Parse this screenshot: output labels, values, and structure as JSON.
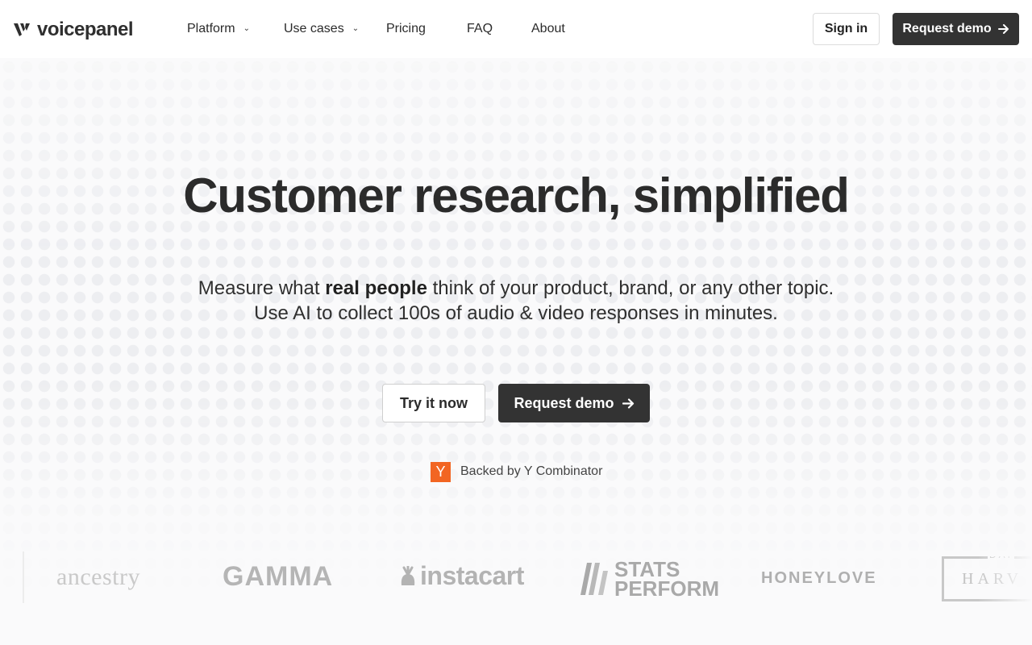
{
  "header": {
    "brand": "voicepanel",
    "nav": [
      {
        "label": "Platform",
        "has_dropdown": true
      },
      {
        "label": "Use cases",
        "has_dropdown": true
      },
      {
        "label": "Pricing",
        "has_dropdown": false
      },
      {
        "label": "FAQ",
        "has_dropdown": false
      },
      {
        "label": "About",
        "has_dropdown": false
      }
    ],
    "sign_in": "Sign in",
    "request_demo": "Request demo"
  },
  "hero": {
    "title": "Customer research, simplified",
    "sub_pre": "Measure what ",
    "sub_bold": "real people",
    "sub_post": " think of your product, brand, or any other topic.",
    "sub_line2": "Use AI to collect 100s of audio & video responses in minutes.",
    "try_button": "Try it now",
    "demo_button": "Request demo",
    "backed_badge": "Y",
    "backed_text": "Backed by Y Combinator"
  },
  "logos": {
    "ancestry": "ancestry",
    "gamma": "GAMMA",
    "instacart": "instacart",
    "stats_line1": "STATS",
    "stats_line2": "PERFORM",
    "honeylove": "HONEYLOVE",
    "harvard_top": "DAI",
    "harvard": "HARV"
  },
  "colors": {
    "primary_dark": "#333333",
    "yc_orange": "#f26522",
    "background": "#fafafb"
  },
  "icons": {
    "arrow": "arrow-right-icon",
    "chevron": "chevron-down-icon"
  }
}
